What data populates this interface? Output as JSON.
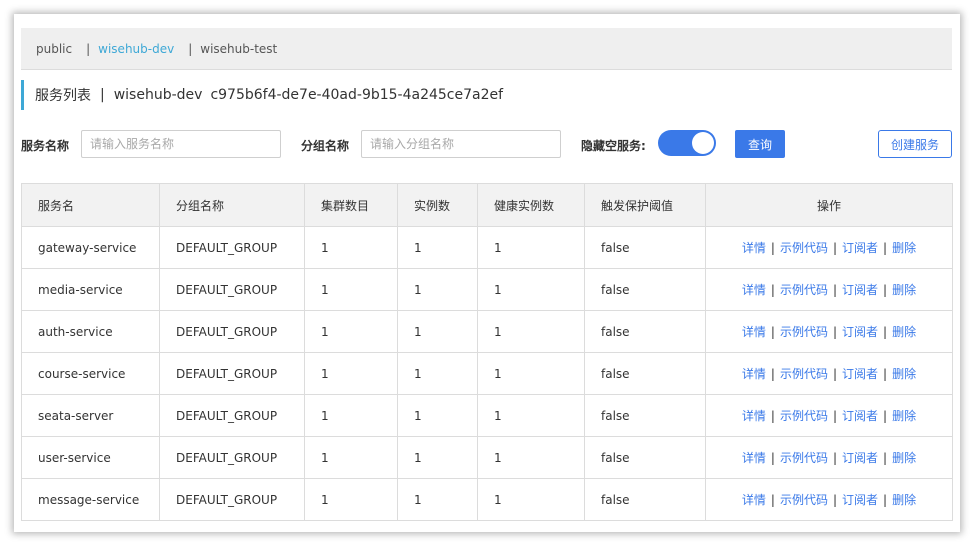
{
  "namespaces": {
    "items": [
      {
        "label": "public"
      },
      {
        "label": "wisehub-dev"
      },
      {
        "label": "wisehub-test"
      }
    ],
    "separator": "|",
    "active_index": 1
  },
  "title": {
    "label": "服务列表",
    "separator": "|",
    "namespace": "wisehub-dev",
    "namespace_id": "c975b6f4-de7e-40ad-9b15-4a245ce7a2ef"
  },
  "search": {
    "service_name_label": "服务名称",
    "service_name_placeholder": "请输入服务名称",
    "service_name_value": "",
    "group_name_label": "分组名称",
    "group_name_placeholder": "请输入分组名称",
    "group_name_value": "",
    "hide_empty_label": "隐藏空服务:",
    "hide_empty_on": true,
    "query_button": "查询",
    "create_button": "创建服务"
  },
  "table": {
    "headers": [
      "服务名",
      "分组名称",
      "集群数目",
      "实例数",
      "健康实例数",
      "触发保护阈值",
      "操作"
    ],
    "actions": [
      "详情",
      "示例代码",
      "订阅者",
      "删除"
    ],
    "action_separator": "|",
    "rows": [
      {
        "name": "gateway-service",
        "group": "DEFAULT_GROUP",
        "clusters": "1",
        "instances": "1",
        "healthy": "1",
        "protect": "false"
      },
      {
        "name": "media-service",
        "group": "DEFAULT_GROUP",
        "clusters": "1",
        "instances": "1",
        "healthy": "1",
        "protect": "false"
      },
      {
        "name": "auth-service",
        "group": "DEFAULT_GROUP",
        "clusters": "1",
        "instances": "1",
        "healthy": "1",
        "protect": "false"
      },
      {
        "name": "course-service",
        "group": "DEFAULT_GROUP",
        "clusters": "1",
        "instances": "1",
        "healthy": "1",
        "protect": "false"
      },
      {
        "name": "seata-server",
        "group": "DEFAULT_GROUP",
        "clusters": "1",
        "instances": "1",
        "healthy": "1",
        "protect": "false"
      },
      {
        "name": "user-service",
        "group": "DEFAULT_GROUP",
        "clusters": "1",
        "instances": "1",
        "healthy": "1",
        "protect": "false"
      },
      {
        "name": "message-service",
        "group": "DEFAULT_GROUP",
        "clusters": "1",
        "instances": "1",
        "healthy": "1",
        "protect": "false"
      }
    ]
  },
  "colors": {
    "accent": "#3a79e8",
    "namespace_active": "#3ea8d6"
  }
}
